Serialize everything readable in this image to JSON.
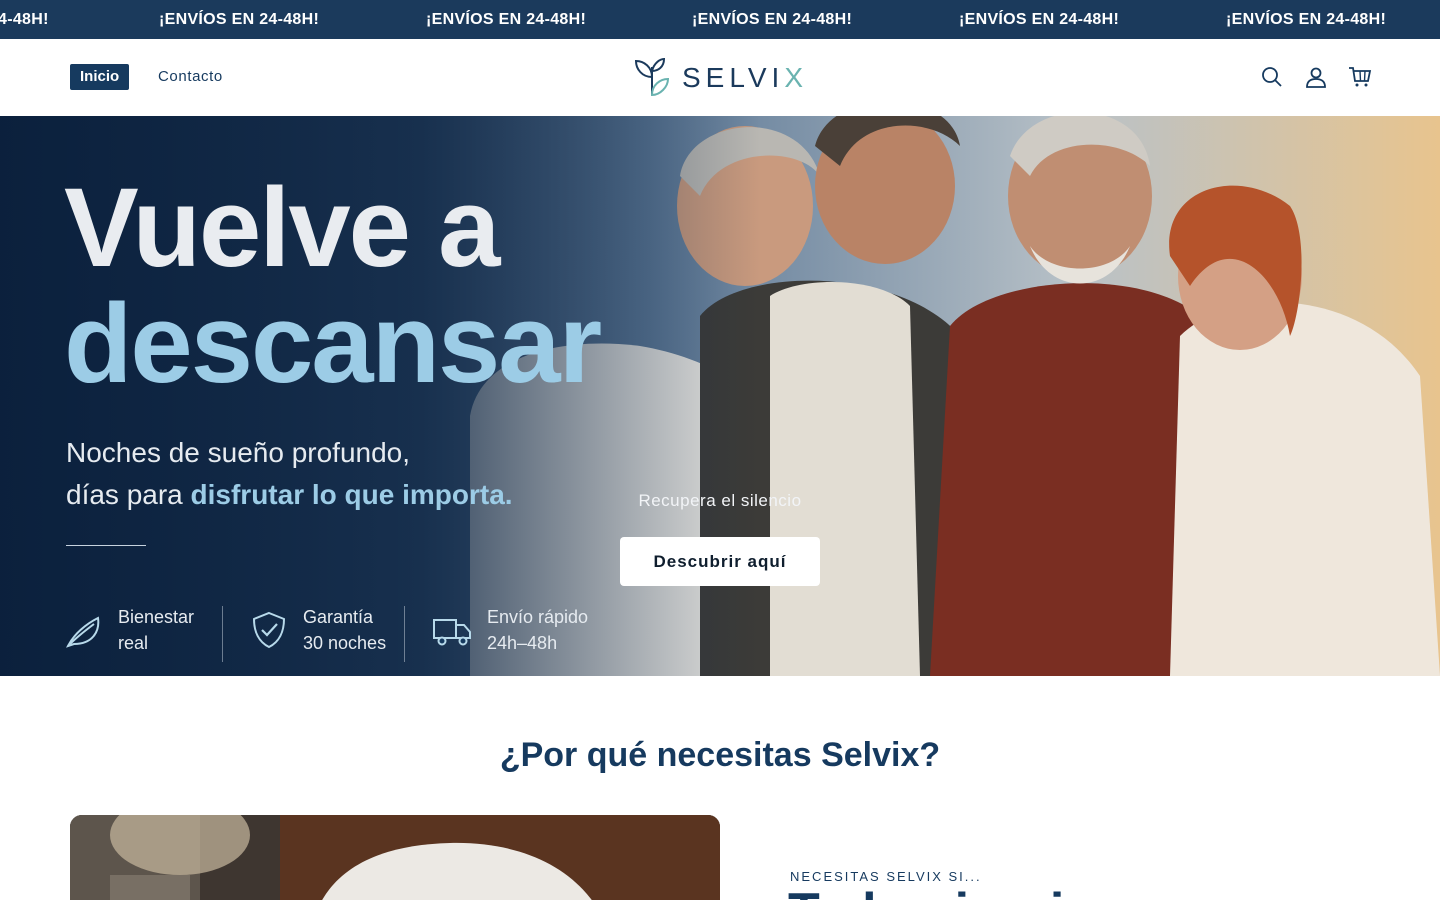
{
  "announcement": {
    "items": [
      "¡ENVÍOS EN 24-48H!",
      "¡ENVÍOS EN 24-48H!",
      "¡ENVÍOS EN 24-48H!",
      "¡ENVÍOS EN 24-48H!",
      "¡ENVÍOS EN 24-48H!",
      "¡ENVÍOS EN 24-48H!"
    ],
    "partial_left": "4-48H!"
  },
  "header": {
    "nav": [
      "Inicio",
      "Contacto"
    ],
    "active_nav": "Inicio",
    "logo": {
      "text": "SELVI",
      "text_accent": "X",
      "icon": "leaf-logo-icon"
    },
    "icons": [
      "search-icon",
      "account-icon",
      "cart-icon"
    ]
  },
  "hero": {
    "title_line1": "Vuelve a",
    "title_line2": "descansar",
    "subtitle_line1": "Noches de sueño profundo,",
    "subtitle_line2_plain": "días para ",
    "subtitle_line2_highlight": "disfrutar lo que importa.",
    "features": [
      {
        "icon": "leaf-icon",
        "line1": "Bienestar",
        "line2": "real"
      },
      {
        "icon": "shield-check-icon",
        "line1": "Garantía",
        "line2": "30 noches"
      },
      {
        "icon": "truck-icon",
        "line1": "Envío rápido",
        "line2": "24h–48h"
      }
    ],
    "tagline": "Recupera el silencio",
    "cta": "Descubrir aquí"
  },
  "why": {
    "title": "¿Por qué necesitas Selvix?",
    "eyebrow": "NECESITAS SELVIX SI...",
    "heading_partial": "Tu luminaria..."
  },
  "colors": {
    "navy": "#163a5f",
    "announce_bg": "#1b3a5c",
    "accent_light_blue": "#9ccce6",
    "logo_teal": "#6ab3b0"
  }
}
